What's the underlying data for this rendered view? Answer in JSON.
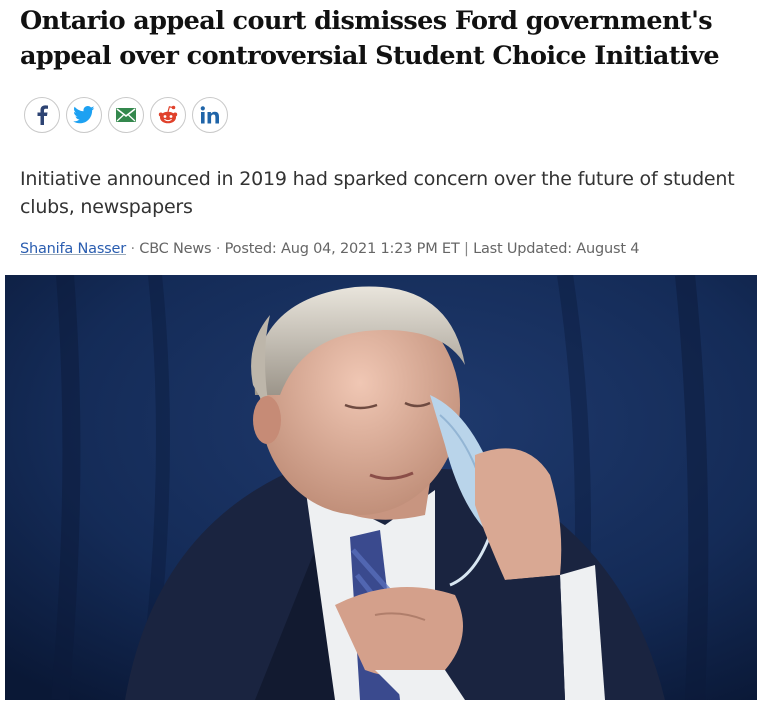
{
  "article": {
    "headline": "Ontario appeal court dismisses Ford government's appeal over controversial Student Choice Initiative",
    "deck": "Initiative announced in 2019 had sparked concern over the future of student clubs, newspapers",
    "byline": {
      "author": "Shanifa Nasser",
      "sep1": " · ",
      "outlet": "CBC News",
      "sep2": " · ",
      "posted": "Posted: Aug 04, 2021 1:23 PM ET",
      "sep3": " | ",
      "updated": "Last Updated: August 4"
    }
  },
  "share": {
    "buttons": [
      {
        "network": "facebook",
        "icon": "facebook-icon",
        "color": "#2d4373"
      },
      {
        "network": "twitter",
        "icon": "twitter-icon",
        "color": "#1da1f2"
      },
      {
        "network": "email",
        "icon": "email-icon",
        "color": "#34884d"
      },
      {
        "network": "reddit",
        "icon": "reddit-icon",
        "color": "#e0412b"
      },
      {
        "network": "linkedin",
        "icon": "linkedin-icon",
        "color": "#1f64a8"
      }
    ]
  },
  "photo": {
    "subject": "man in dark suit removing a blue face mask against a dark blue background"
  }
}
